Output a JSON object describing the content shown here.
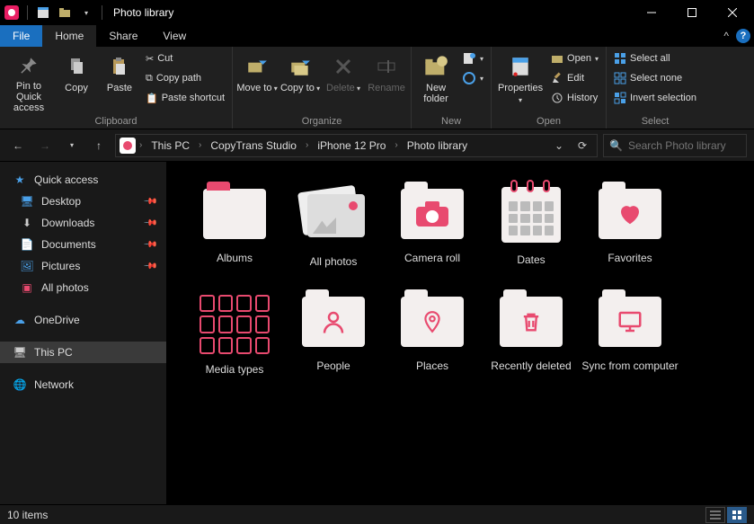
{
  "title": "Photo library",
  "tabs": {
    "file": "File",
    "home": "Home",
    "share": "Share",
    "view": "View"
  },
  "ribbon": {
    "clipboard": {
      "label": "Clipboard",
      "pin": "Pin to Quick access",
      "copy": "Copy",
      "paste": "Paste",
      "cut": "Cut",
      "copypath": "Copy path",
      "pasteshortcut": "Paste shortcut"
    },
    "organize": {
      "label": "Organize",
      "moveto": "Move to",
      "copyto": "Copy to",
      "delete": "Delete",
      "rename": "Rename"
    },
    "new": {
      "label": "New",
      "newfolder": "New folder"
    },
    "open": {
      "label": "Open",
      "properties": "Properties",
      "open": "Open",
      "edit": "Edit",
      "history": "History"
    },
    "select": {
      "label": "Select",
      "all": "Select all",
      "none": "Select none",
      "invert": "Invert selection"
    }
  },
  "breadcrumb": [
    "This PC",
    "CopyTrans Studio",
    "iPhone 12 Pro",
    "Photo library"
  ],
  "search_placeholder": "Search Photo library",
  "sidebar": {
    "quick": "Quick access",
    "desktop": "Desktop",
    "downloads": "Downloads",
    "documents": "Documents",
    "pictures": "Pictures",
    "allphotos": "All photos",
    "onedrive": "OneDrive",
    "thispc": "This PC",
    "network": "Network"
  },
  "items": [
    "Albums",
    "All photos",
    "Camera roll",
    "Dates",
    "Favorites",
    "Media types",
    "People",
    "Places",
    "Recently deleted",
    "Sync from computer"
  ],
  "status": "10 items"
}
